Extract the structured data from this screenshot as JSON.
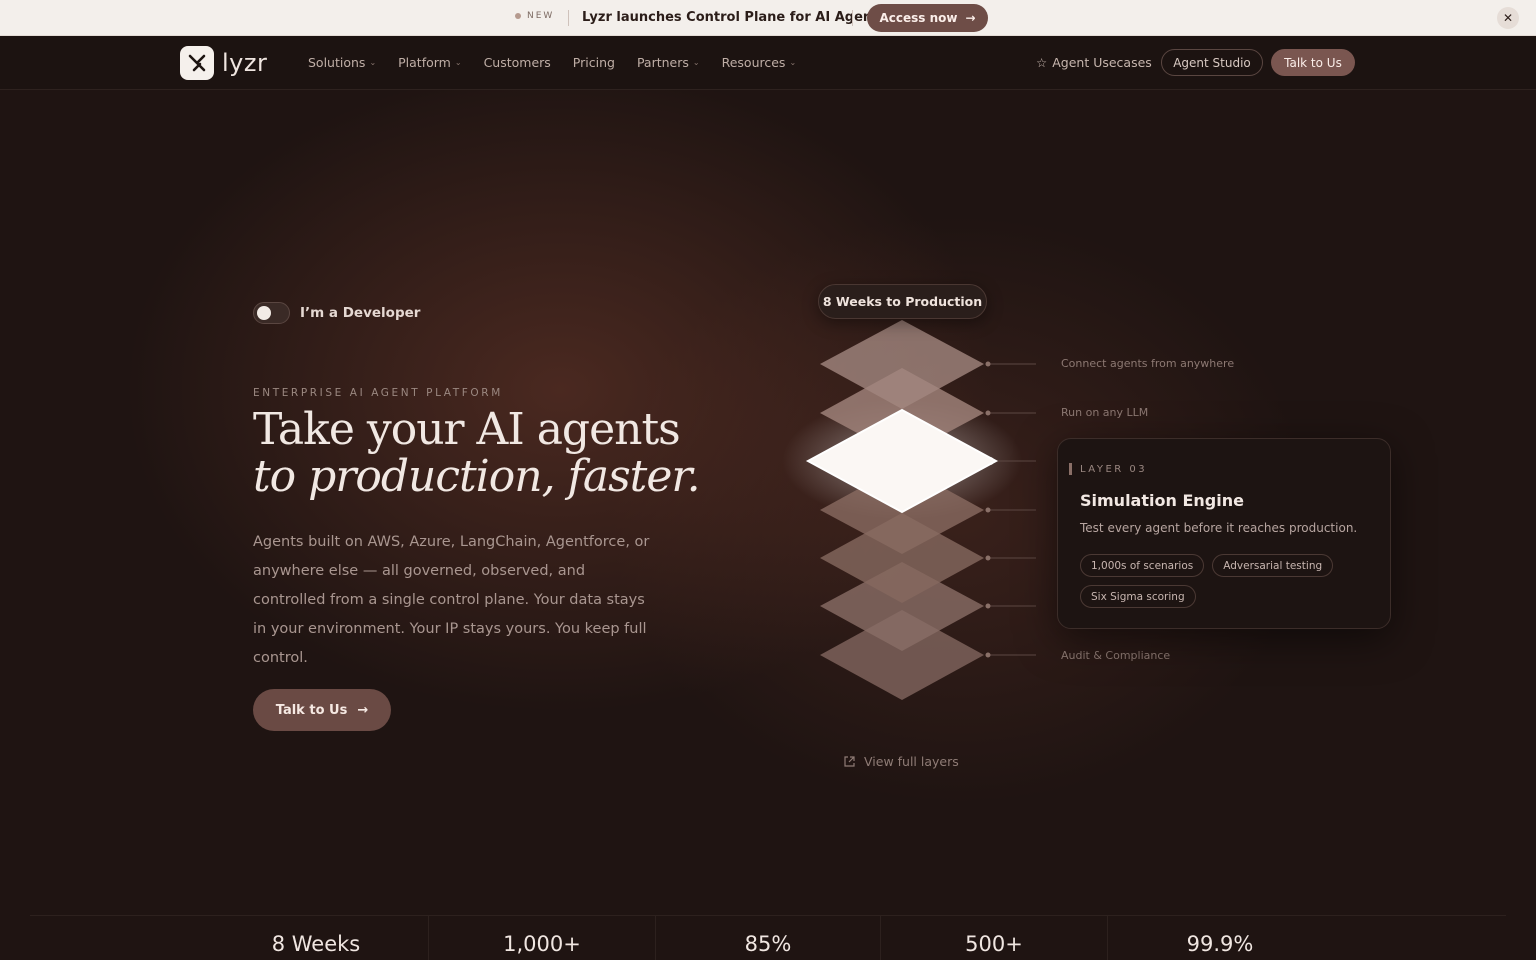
{
  "announcement": {
    "badge": "NEW",
    "message": "Lyzr launches Control Plane for AI Agents",
    "cta": "Access now",
    "cta_arrow": "→",
    "close": "✕"
  },
  "nav": {
    "logo_text": "lyzr",
    "items": [
      {
        "label": "Solutions",
        "has_menu": true
      },
      {
        "label": "Platform",
        "has_menu": true
      },
      {
        "label": "Customers",
        "has_menu": false
      },
      {
        "label": "Pricing",
        "has_menu": false
      },
      {
        "label": "Partners",
        "has_menu": true
      },
      {
        "label": "Resources",
        "has_menu": true
      }
    ],
    "usecases": "Agent Usecases",
    "studio": "Agent Studio",
    "talk": "Talk to Us"
  },
  "hero": {
    "toggle_label": "I’m a Developer",
    "eyebrow": "ENTERPRISE AI AGENT PLATFORM",
    "headline_1": "Take your AI agents",
    "headline_2": "to production, faster.",
    "description": "Agents built on AWS, Azure, LangChain, Agentforce, or anywhere else — all governed, observed, and controlled from a single control plane. Your data stays in your environment. Your IP stays yours. You keep full control.",
    "cta": "Talk to Us",
    "cta_arrow": "→"
  },
  "stack": {
    "pill": "8 Weeks to Production",
    "labels": {
      "connect": "Connect agents from anywhere",
      "llm": "Run on any LLM",
      "audit": "Audit & Compliance"
    },
    "active_card": {
      "kicker": "LAYER 03",
      "title": "Simulation Engine",
      "text": "Test every agent before it reaches production.",
      "chips": [
        "1,000s of scenarios",
        "Adversarial testing",
        "Six Sigma scoring"
      ]
    },
    "view_full": "View full layers"
  },
  "stats": [
    "8 Weeks",
    "1,000+",
    "85%",
    "500+",
    "99.9%"
  ],
  "colors": {
    "background": "#1f1412",
    "accent": "#6e4d47",
    "announcement_bg": "#f3efeb"
  }
}
